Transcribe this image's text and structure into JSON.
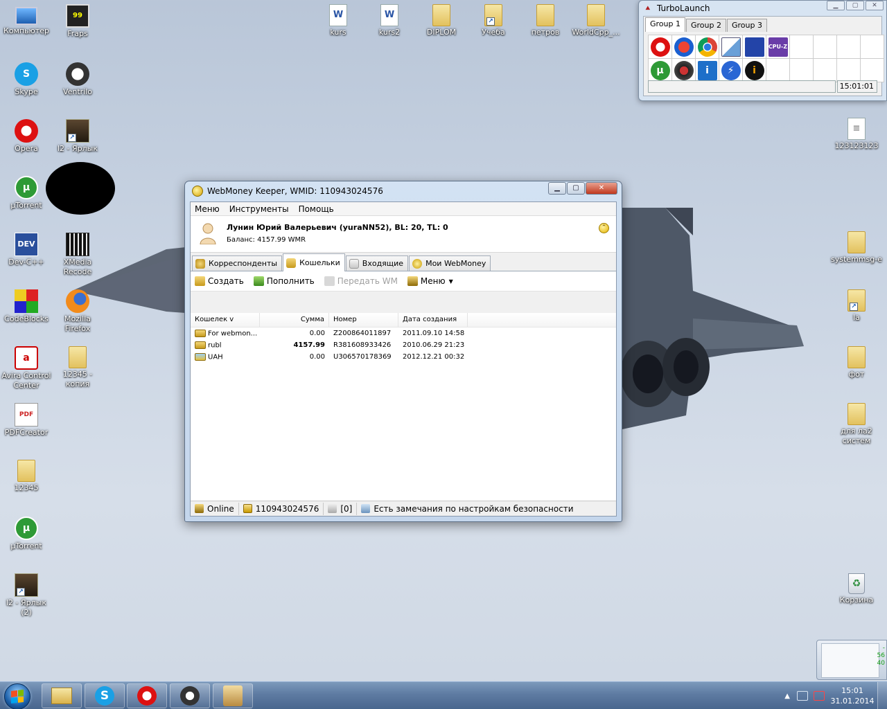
{
  "desktop": {
    "icons_left": [
      {
        "label": "Компьютер",
        "icon": "computer-icon"
      },
      {
        "label": "Skype",
        "icon": "skype-icon"
      },
      {
        "label": "Opera",
        "icon": "opera-icon"
      },
      {
        "label": "µTorrent",
        "icon": "utorrent-icon"
      },
      {
        "label": "Dev-C++",
        "icon": "devcpp-icon"
      },
      {
        "label": "CodeBlocks",
        "icon": "codeblocks-icon"
      },
      {
        "label": "Avira Control Center",
        "icon": "avira-icon"
      },
      {
        "label": "PDFCreator",
        "icon": "pdfcreator-icon"
      },
      {
        "label": "12345",
        "icon": "folder-icon"
      },
      {
        "label": "µTorrent",
        "icon": "utorrent-icon"
      },
      {
        "label": "l2 - Ярлык (2)",
        "icon": "l2-shortcut-icon"
      }
    ],
    "icons_col2": [
      {
        "label": "Fraps",
        "icon": "fraps-icon"
      },
      {
        "label": "Ventrilo",
        "icon": "ventrilo-icon"
      },
      {
        "label": "l2 - Ярлык",
        "icon": "l2-shortcut-icon"
      },
      {
        "label": "XMedia Recode",
        "icon": "xmedia-recode-icon"
      },
      {
        "label": "Mozilla Firefox",
        "icon": "firefox-icon"
      },
      {
        "label": "12345 - копия",
        "icon": "folder-icon"
      }
    ],
    "icons_top": [
      {
        "label": "kurs",
        "icon": "word-doc-icon"
      },
      {
        "label": "kurs2",
        "icon": "word-doc-icon"
      },
      {
        "label": "DIPLOM",
        "icon": "folder-icon"
      },
      {
        "label": "Учеба",
        "icon": "folder-shortcut-icon"
      },
      {
        "label": "петров",
        "icon": "folder-icon"
      },
      {
        "label": "WorldCpp_...",
        "icon": "folder-icon"
      }
    ],
    "icons_right": [
      {
        "label": "123123123",
        "icon": "text-doc-icon"
      },
      {
        "label": "systemmsg-e",
        "icon": "folder-icon"
      },
      {
        "label": "la",
        "icon": "folder-shortcut-icon"
      },
      {
        "label": "фот",
        "icon": "folder-icon"
      },
      {
        "label": "для ла2 систем",
        "icon": "folder-icon"
      },
      {
        "label": "Корзина",
        "icon": "recycle-bin-icon"
      }
    ]
  },
  "turbolaunch": {
    "title": "TurboLaunch",
    "tabs": [
      "Group 1",
      "Group 2",
      "Group 3"
    ],
    "active_tab": "Group 1",
    "row1_icons": [
      "opera-icon",
      "ccleaner-icon",
      "chrome-icon",
      "notepad-icon",
      "save-disk-icon",
      "cpuz-icon"
    ],
    "row2_icons": [
      "utorrent-icon",
      "radar-icon",
      "info-panel-icon",
      "lightning-icon",
      "info-icon"
    ],
    "cpuz_label": "CPU-Z",
    "time": "15:01:01"
  },
  "webmoney": {
    "title": "WebMoney Keeper, WMID: 110943024576",
    "menu": [
      "Меню",
      "Инструменты",
      "Помощь"
    ],
    "user": "Лунин Юрий Валерьевич (yuraNN52), BL: 20, TL: 0",
    "balance": "Баланс: 4157.99 WMR",
    "tabs": [
      {
        "label": "Корреспонденты"
      },
      {
        "label": "Кошельки"
      },
      {
        "label": "Входящие"
      },
      {
        "label": "Мои WebMoney"
      }
    ],
    "active_tab": "Кошельки",
    "toolbar": {
      "create": "Создать",
      "topup": "Пополнить",
      "transfer": "Передать WM",
      "menu": "Меню"
    },
    "columns": [
      "Кошелек  v",
      "Сумма",
      "Номер",
      "Дата создания"
    ],
    "rows": [
      {
        "name": "For webmon...",
        "sum": "0.00",
        "number": "Z200864011897",
        "date": "2011.09.10 14:58"
      },
      {
        "name": "rubl",
        "sum": "4157.99",
        "number": "R381608933426",
        "date": "2010.06.29 21:23"
      },
      {
        "name": "UAH",
        "sum": "0.00",
        "number": "U306570178369",
        "date": "2012.12.21 00:32"
      }
    ],
    "status": {
      "online": "Online",
      "wmid": "110943024576",
      "messages": "[0]",
      "warning": "Есть замечания по настройкам безопасности"
    }
  },
  "gadget": {
    "values": [
      "-",
      "56",
      "40"
    ]
  },
  "taskbar": {
    "pinned": [
      "explorer-icon",
      "skype-icon",
      "opera-icon",
      "ventrilo-icon",
      "game-icon"
    ],
    "time": "15:01",
    "date": "31.01.2014"
  },
  "colors": {
    "accent": "#1b5fa8",
    "wm_gold": "#d6a100"
  }
}
